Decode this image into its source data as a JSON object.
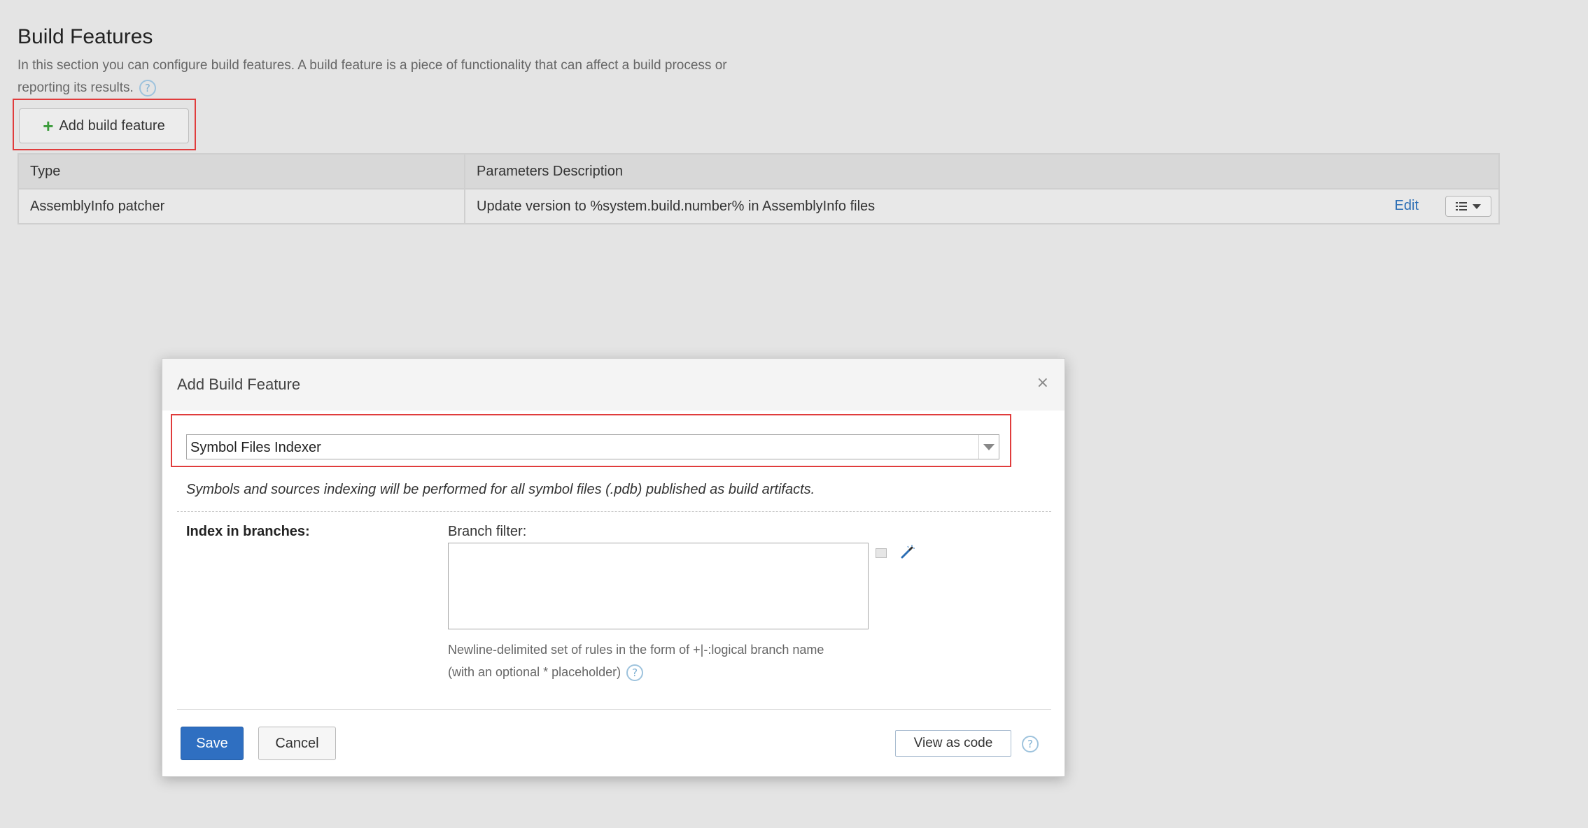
{
  "section": {
    "title": "Build Features",
    "description": "In this section you can configure build features. A build feature is a piece of functionality that can affect a build process or reporting its results.",
    "help_glyph": "?",
    "add_button_label": "Add build feature",
    "add_button_icon": "plus-icon"
  },
  "table": {
    "headers": [
      "Type",
      "Parameters Description"
    ],
    "rows": [
      {
        "type": "AssemblyInfo patcher",
        "description": "Update version to %system.build.number% in AssemblyInfo files",
        "edit_label": "Edit"
      }
    ]
  },
  "dialog": {
    "title": "Add Build Feature",
    "close_glyph": "×",
    "selected_feature": "Symbol Files Indexer",
    "feature_description": "Symbols and sources indexing will be performed for all symbol files (.pdb) published as build artifacts.",
    "row_label": "Index in branches:",
    "branch_filter_label": "Branch filter:",
    "branch_filter_value": "",
    "hint": "Newline-delimited set of rules in the form of +|-:logical branch name (with an optional * placeholder)",
    "save_label": "Save",
    "cancel_label": "Cancel",
    "view_as_code_label": "View as code"
  },
  "colors": {
    "highlight": "#e03c3c",
    "primary": "#2f6fc1",
    "link": "#2d6fb5",
    "plus": "#3a9b3a"
  }
}
